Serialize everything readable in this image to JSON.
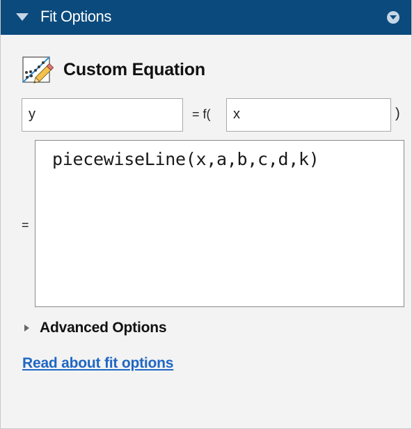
{
  "panel": {
    "title": "Fit Options"
  },
  "fit_type": {
    "heading": "Custom Equation",
    "icon": "custom-equation-icon"
  },
  "equation": {
    "dependent_variable": "y",
    "function_prefix": "= f(",
    "independent_variable": "x",
    "function_suffix": ")",
    "equals_label": "=",
    "expression": "piecewiseLine(x,a,b,c,d,k)"
  },
  "advanced": {
    "label": "Advanced Options",
    "expanded": false
  },
  "help": {
    "link_text": "Read about fit options"
  },
  "colors": {
    "titlebar": "#0b4a7d",
    "link": "#1f67c4",
    "panel_background": "#f3f3f3"
  }
}
